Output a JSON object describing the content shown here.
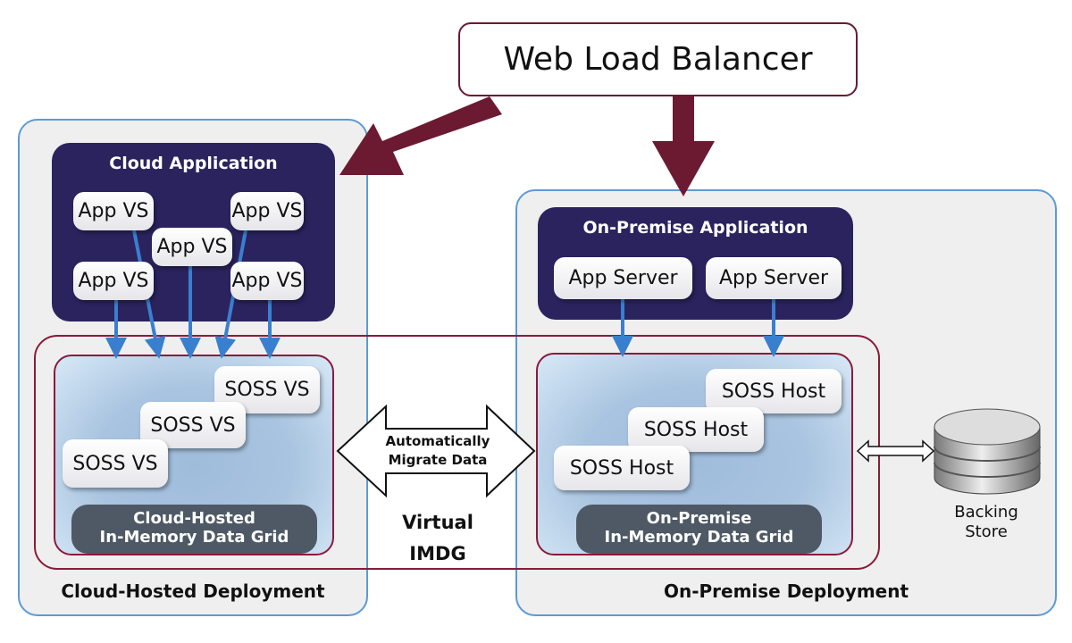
{
  "load_balancer": {
    "label": "Web Load Balancer"
  },
  "cloud": {
    "deployment_label": "Cloud-Hosted Deployment",
    "app_title": "Cloud Application",
    "app_nodes": [
      "App VS",
      "App VS",
      "App VS",
      "App VS",
      "App VS"
    ],
    "grid_nodes": [
      "SOSS VS",
      "SOSS VS",
      "SOSS VS"
    ],
    "grid_label_1": "Cloud-Hosted",
    "grid_label_2": "In-Memory Data Grid"
  },
  "onprem": {
    "deployment_label": "On-Premise Deployment",
    "app_title": "On-Premise Application",
    "app_nodes": [
      "App Server",
      "App Server"
    ],
    "grid_nodes": [
      "SOSS Host",
      "SOSS Host",
      "SOSS Host"
    ],
    "grid_label_1": "On-Premise",
    "grid_label_2": "In-Memory Data Grid",
    "backing_store_1": "Backing",
    "backing_store_2": "Store"
  },
  "migrate": {
    "line1": "Automatically",
    "line2": "Migrate Data"
  },
  "virtual": {
    "line1": "Virtual",
    "line2": "IMDG"
  },
  "colors": {
    "maroon": "#6b1a32",
    "navy": "#2b235e",
    "blue_border": "#5b9bd5",
    "arrow_blue": "#3a7fcf"
  }
}
